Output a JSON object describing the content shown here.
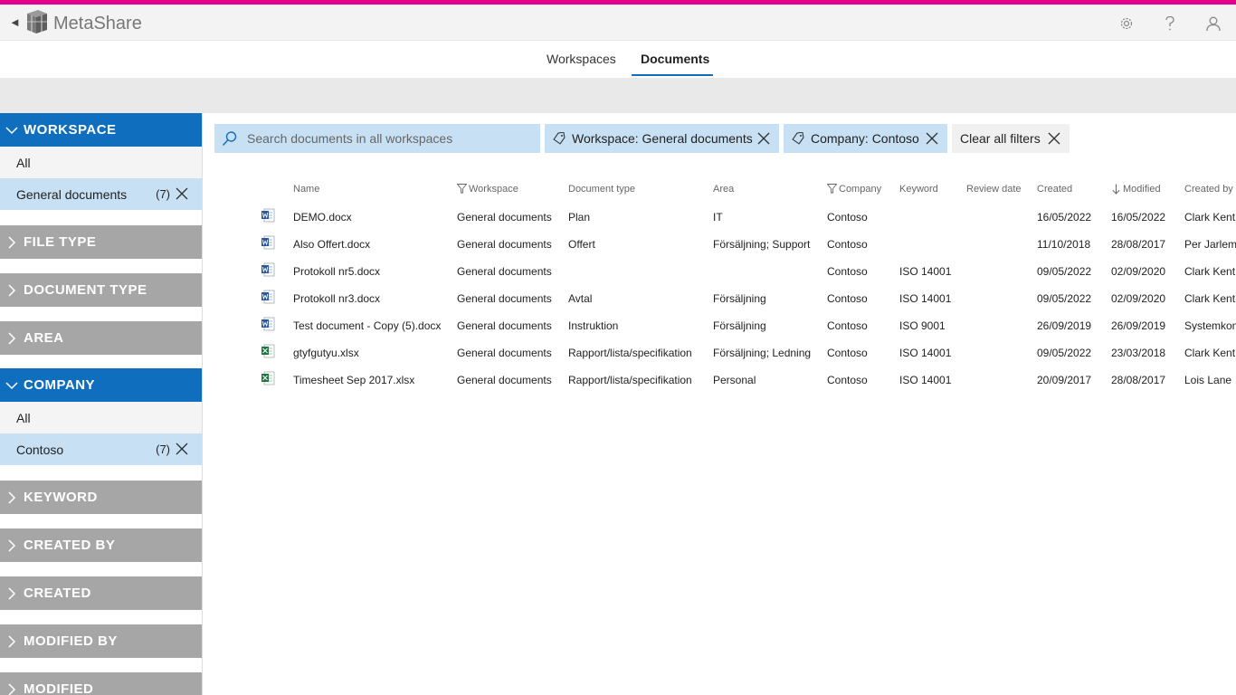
{
  "app": {
    "title": "MetaShare",
    "back_glyph": "◄"
  },
  "colors": {
    "accent": "#e3008c",
    "brand_blue": "#106ebe",
    "selection": "#c7e0f4",
    "facet_closed": "#a6a6a6"
  },
  "top_icons": [
    "gear-icon",
    "help-icon",
    "user-icon"
  ],
  "tabs": [
    {
      "label": "Workspaces",
      "active": false
    },
    {
      "label": "Documents",
      "active": true
    }
  ],
  "sidebar": {
    "workspace": {
      "label": "WORKSPACE",
      "all": "All",
      "selected": "General documents",
      "count": "(7)"
    },
    "file_type": "FILE TYPE",
    "document_type": "DOCUMENT TYPE",
    "area": "AREA",
    "company": {
      "label": "COMPANY",
      "all": "All",
      "selected": "Contoso",
      "count": "(7)"
    },
    "keyword": "KEYWORD",
    "created_by": "CREATED BY",
    "created": "CREATED",
    "modified_by": "MODIFIED BY",
    "modified": "MODIFIED"
  },
  "search": {
    "placeholder": "Search documents in all workspaces",
    "value": ""
  },
  "filters": {
    "chip1": "Workspace: General documents",
    "chip2": "Company: Contoso",
    "clear_all": "Clear all filters"
  },
  "table": {
    "headers": {
      "name": "Name",
      "workspace": "Workspace",
      "document_type": "Document type",
      "area": "Area",
      "company": "Company",
      "keyword": "Keyword",
      "review_date": "Review date",
      "created": "Created",
      "modified": "Modified",
      "created_by": "Created by"
    },
    "rows": [
      {
        "type": "word",
        "name": "DEMO.docx",
        "workspace": "General documents",
        "document_type": "Plan",
        "area": "IT",
        "company": "Contoso",
        "keyword": "",
        "review_date": "",
        "created": "16/05/2022",
        "modified": "16/05/2022",
        "created_by": "Clark Kent"
      },
      {
        "type": "word",
        "name": "Also Offert.docx",
        "workspace": "General documents",
        "document_type": "Offert",
        "area": "Försäljning; Support",
        "company": "Contoso",
        "keyword": "",
        "review_date": "",
        "created": "11/10/2018",
        "modified": "28/08/2017",
        "created_by": "Per Jarlema"
      },
      {
        "type": "word",
        "name": "Protokoll nr5.docx",
        "workspace": "General documents",
        "document_type": "",
        "area": "",
        "company": "Contoso",
        "keyword": "ISO 14001",
        "review_date": "",
        "created": "09/05/2022",
        "modified": "02/09/2020",
        "created_by": "Clark Kent"
      },
      {
        "type": "word",
        "name": "Protokoll nr3.docx",
        "workspace": "General documents",
        "document_type": "Avtal",
        "area": "Försäljning",
        "company": "Contoso",
        "keyword": "ISO 14001",
        "review_date": "",
        "created": "09/05/2022",
        "modified": "02/09/2020",
        "created_by": "Clark Kent"
      },
      {
        "type": "word",
        "name": "Test document - Copy (5).docx",
        "workspace": "General documents",
        "document_type": "Instruktion",
        "area": "Försäljning",
        "company": "Contoso",
        "keyword": "ISO 9001",
        "review_date": "",
        "created": "26/09/2019",
        "modified": "26/09/2019",
        "created_by": "Systemkon"
      },
      {
        "type": "excel",
        "name": "gtyfgutyu.xlsx",
        "workspace": "General documents",
        "document_type": "Rapport/lista/specifikation",
        "area": "Försäljning; Ledning",
        "company": "Contoso",
        "keyword": "ISO 14001",
        "review_date": "",
        "created": "09/05/2022",
        "modified": "23/03/2018",
        "created_by": "Clark Kent"
      },
      {
        "type": "excel",
        "name": "Timesheet Sep 2017.xlsx",
        "workspace": "General documents",
        "document_type": "Rapport/lista/specifikation",
        "area": "Personal",
        "company": "Contoso",
        "keyword": "ISO 14001",
        "review_date": "",
        "created": "20/09/2017",
        "modified": "28/08/2017",
        "created_by": "Lois Lane"
      }
    ]
  }
}
